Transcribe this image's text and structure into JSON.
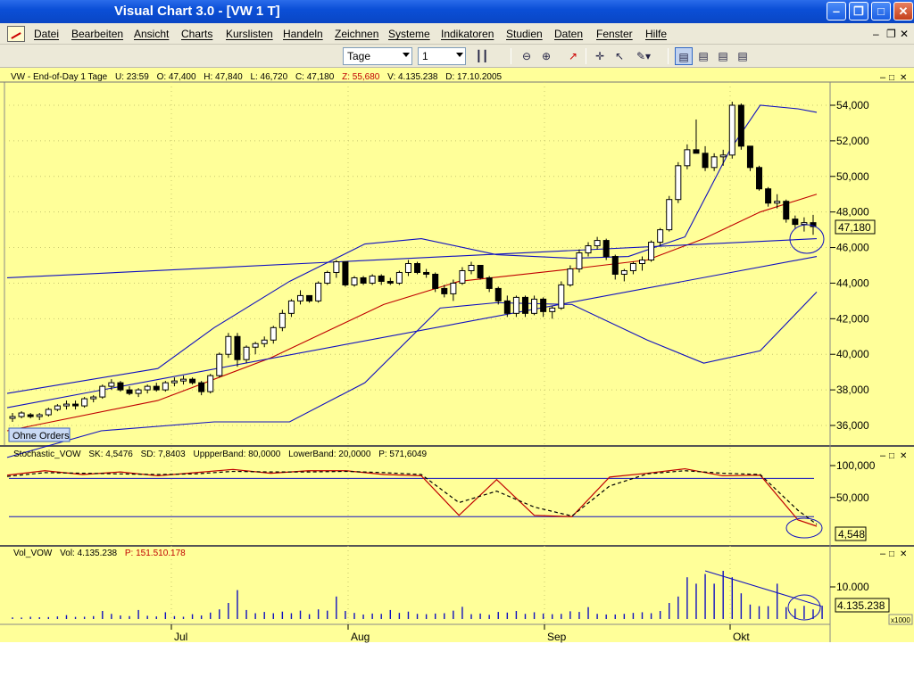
{
  "window": {
    "title": "Visual Chart  3.0 - [VW 1 T]"
  },
  "menu": [
    "Datei",
    "Bearbeiten",
    "Ansicht",
    "Charts",
    "Kurslisten",
    "Handeln",
    "Zeichnen",
    "Systeme",
    "Indikatoren",
    "Studien",
    "Daten",
    "Fenster",
    "Hilfe"
  ],
  "toolbar": {
    "period": "Tage",
    "compression": "1"
  },
  "price_header": {
    "symbol": "VW - End-of-Day 1 Tage",
    "u": "U: 23:59",
    "o": "O: 47,400",
    "h": "H: 47,840",
    "l": "L: 46,720",
    "c": "C: 47,180",
    "z": "Z: 55,680",
    "v": "V: 4.135.238",
    "d": "D: 17.10.2005"
  },
  "price_last": "47,180",
  "orders_label": "Ohne Orders",
  "stoch_header": {
    "name": "Stochastic_VOW",
    "sk": "SK: 4,5476",
    "sd": "SD: 7,8403",
    "upper": "UppperBand: 80,0000",
    "lower": "LowerBand: 20,0000",
    "p": "P: 571,6049"
  },
  "stoch_last": "4,548",
  "vol_header": {
    "name": "Vol_VOW",
    "vol": "Vol: 4.135.238",
    "p": "P: 151.510.178"
  },
  "vol_last": "4.135.238",
  "vol_scale": "x1000",
  "colors": {
    "panel_bg": "#ffff99",
    "candle_up": "#ffffff",
    "candle_down": "#000000",
    "bollinger": "#1010c0",
    "ma": "#c00000",
    "z_value": "#c00000"
  },
  "chart_data": [
    {
      "type": "candlestick",
      "title": "VW - End-of-Day 1 Tage",
      "x_labels": [
        "Jul",
        "Aug",
        "Sep",
        "Okt"
      ],
      "y_ticks": [
        "54,000",
        "52,000",
        "50,000",
        "48,000",
        "46,000",
        "44,000",
        "42,000",
        "40,000",
        "38,000",
        "36,000"
      ],
      "ylim": [
        35000,
        55000
      ],
      "candles": [
        [
          36400,
          36700,
          36200,
          36500
        ],
        [
          36500,
          36800,
          36400,
          36700
        ],
        [
          36600,
          36700,
          36400,
          36500
        ],
        [
          36500,
          36700,
          36300,
          36600
        ],
        [
          36600,
          37000,
          36500,
          36900
        ],
        [
          36900,
          37200,
          36800,
          37100
        ],
        [
          37100,
          37400,
          36900,
          37200
        ],
        [
          37200,
          37400,
          36900,
          37100
        ],
        [
          37100,
          37600,
          37000,
          37500
        ],
        [
          37500,
          37700,
          37300,
          37600
        ],
        [
          37600,
          38300,
          37500,
          38200
        ],
        [
          38200,
          38600,
          38000,
          38400
        ],
        [
          38400,
          38500,
          37900,
          38000
        ],
        [
          38000,
          38200,
          37700,
          37800
        ],
        [
          37800,
          38100,
          37600,
          38000
        ],
        [
          38000,
          38300,
          37800,
          38200
        ],
        [
          38200,
          38400,
          37900,
          38000
        ],
        [
          38000,
          38500,
          37900,
          38400
        ],
        [
          38400,
          38700,
          38200,
          38500
        ],
        [
          38500,
          38800,
          38300,
          38600
        ],
        [
          38600,
          38700,
          38300,
          38400
        ],
        [
          38400,
          38500,
          37700,
          37900
        ],
        [
          37900,
          38900,
          37800,
          38800
        ],
        [
          38800,
          40100,
          38700,
          40000
        ],
        [
          40000,
          41200,
          39800,
          41000
        ],
        [
          41000,
          41200,
          39300,
          39700
        ],
        [
          39700,
          40500,
          39500,
          40400
        ],
        [
          40400,
          40700,
          40000,
          40600
        ],
        [
          40600,
          41000,
          40400,
          40800
        ],
        [
          40800,
          41600,
          40600,
          41500
        ],
        [
          41500,
          42500,
          41300,
          42300
        ],
        [
          42300,
          43100,
          42100,
          43000
        ],
        [
          43000,
          43600,
          42800,
          43300
        ],
        [
          43300,
          43300,
          42900,
          43000
        ],
        [
          43000,
          44100,
          42900,
          44000
        ],
        [
          44000,
          44700,
          43900,
          44600
        ],
        [
          44600,
          45300,
          44300,
          45200
        ],
        [
          45200,
          45200,
          43800,
          43900
        ],
        [
          43900,
          44400,
          43800,
          44300
        ],
        [
          44300,
          44400,
          43900,
          44000
        ],
        [
          44000,
          44500,
          43900,
          44400
        ],
        [
          44400,
          44500,
          43900,
          44100
        ],
        [
          44100,
          44300,
          43900,
          44000
        ],
        [
          44000,
          44700,
          43900,
          44600
        ],
        [
          44600,
          45300,
          44400,
          45100
        ],
        [
          45100,
          45200,
          44500,
          44600
        ],
        [
          44600,
          44800,
          44300,
          44500
        ],
        [
          44500,
          44600,
          43500,
          43700
        ],
        [
          43700,
          43900,
          43200,
          43400
        ],
        [
          43400,
          44200,
          43000,
          44000
        ],
        [
          44000,
          44900,
          43900,
          44700
        ],
        [
          44700,
          45200,
          44500,
          45000
        ],
        [
          45000,
          45000,
          44200,
          44300
        ],
        [
          44300,
          44400,
          43500,
          43700
        ],
        [
          43700,
          43800,
          42800,
          43000
        ],
        [
          43000,
          43300,
          42100,
          42300
        ],
        [
          42300,
          43300,
          42100,
          43200
        ],
        [
          43200,
          43300,
          42100,
          42300
        ],
        [
          42300,
          43300,
          42200,
          43100
        ],
        [
          43100,
          43200,
          42100,
          42400
        ],
        [
          42400,
          42700,
          42000,
          42600
        ],
        [
          42600,
          44100,
          42500,
          43900
        ],
        [
          43900,
          45000,
          43800,
          44800
        ],
        [
          44800,
          45900,
          44600,
          45700
        ],
        [
          45700,
          46300,
          45500,
          46100
        ],
        [
          46100,
          46600,
          45900,
          46400
        ],
        [
          46400,
          46500,
          45300,
          45500
        ],
        [
          45500,
          45600,
          44200,
          44500
        ],
        [
          44500,
          44800,
          44100,
          44700
        ],
        [
          44700,
          45200,
          44500,
          45100
        ],
        [
          45100,
          45500,
          44700,
          45300
        ],
        [
          45300,
          46400,
          45200,
          46300
        ],
        [
          46300,
          47100,
          46100,
          47000
        ],
        [
          47000,
          48900,
          46900,
          48700
        ],
        [
          48700,
          50800,
          48500,
          50600
        ],
        [
          50600,
          51800,
          50400,
          51500
        ],
        [
          51500,
          53200,
          51300,
          51300
        ],
        [
          51300,
          51700,
          50300,
          50500
        ],
        [
          50500,
          51300,
          50300,
          51100
        ],
        [
          51100,
          51500,
          50600,
          51200
        ],
        [
          51200,
          54200,
          51000,
          54000
        ],
        [
          54000,
          54100,
          51500,
          51700
        ],
        [
          51700,
          51700,
          50300,
          50500
        ],
        [
          50500,
          50600,
          49200,
          49300
        ],
        [
          49300,
          49400,
          48300,
          48500
        ],
        [
          48500,
          49000,
          48200,
          48600
        ],
        [
          48600,
          48700,
          47400,
          47600
        ],
        [
          47600,
          47800,
          47100,
          47300
        ],
        [
          47300,
          47700,
          46900,
          47400
        ],
        [
          47400,
          47840,
          46720,
          47180
        ]
      ],
      "bollinger_upper": [
        [
          0,
          37800
        ],
        [
          40,
          39200
        ],
        [
          55,
          41500
        ],
        [
          75,
          44100
        ],
        [
          95,
          46200
        ],
        [
          110,
          46500
        ],
        [
          130,
          45600
        ],
        [
          150,
          45400
        ],
        [
          165,
          45500
        ],
        [
          180,
          46600
        ],
        [
          192,
          51500
        ],
        [
          200,
          54000
        ],
        [
          210,
          53800
        ],
        [
          215,
          53600
        ]
      ],
      "bollinger_lower": [
        [
          0,
          34200
        ],
        [
          25,
          35700
        ],
        [
          55,
          36200
        ],
        [
          75,
          36200
        ],
        [
          95,
          38400
        ],
        [
          115,
          42600
        ],
        [
          130,
          42900
        ],
        [
          150,
          42800
        ],
        [
          170,
          40800
        ],
        [
          185,
          39500
        ],
        [
          200,
          40200
        ],
        [
          215,
          43500
        ]
      ],
      "moving_average": [
        [
          0,
          35700
        ],
        [
          40,
          37400
        ],
        [
          70,
          39800
        ],
        [
          100,
          42800
        ],
        [
          120,
          44100
        ],
        [
          150,
          44800
        ],
        [
          170,
          45300
        ],
        [
          185,
          46500
        ],
        [
          200,
          48000
        ],
        [
          215,
          49000
        ]
      ],
      "trendlines": [
        [
          [
            0,
            44300
          ],
          [
            215,
            46500
          ]
        ],
        [
          [
            0,
            37000
          ],
          [
            215,
            45500
          ]
        ]
      ]
    },
    {
      "type": "line",
      "title": "Stochastic_VOW",
      "y_ticks": [
        "100,000",
        "50,000"
      ],
      "bands": [
        80,
        20
      ],
      "sk": [
        [
          0,
          85
        ],
        [
          10,
          92
        ],
        [
          20,
          86
        ],
        [
          30,
          90
        ],
        [
          40,
          84
        ],
        [
          50,
          89
        ],
        [
          60,
          94
        ],
        [
          70,
          88
        ],
        [
          80,
          92
        ],
        [
          90,
          92
        ],
        [
          100,
          86
        ],
        [
          110,
          84
        ],
        [
          120,
          22
        ],
        [
          130,
          78
        ],
        [
          140,
          22
        ],
        [
          150,
          20
        ],
        [
          160,
          82
        ],
        [
          170,
          88
        ],
        [
          180,
          95
        ],
        [
          190,
          84
        ],
        [
          200,
          85
        ],
        [
          210,
          15
        ],
        [
          215,
          5
        ]
      ],
      "sd": [
        [
          0,
          83
        ],
        [
          10,
          89
        ],
        [
          20,
          88
        ],
        [
          30,
          87
        ],
        [
          40,
          86
        ],
        [
          50,
          87
        ],
        [
          60,
          91
        ],
        [
          70,
          90
        ],
        [
          80,
          90
        ],
        [
          90,
          91
        ],
        [
          100,
          89
        ],
        [
          110,
          86
        ],
        [
          120,
          42
        ],
        [
          130,
          60
        ],
        [
          140,
          35
        ],
        [
          150,
          21
        ],
        [
          160,
          68
        ],
        [
          170,
          87
        ],
        [
          180,
          92
        ],
        [
          190,
          88
        ],
        [
          200,
          86
        ],
        [
          210,
          30
        ],
        [
          215,
          8
        ]
      ]
    },
    {
      "type": "bar",
      "title": "Vol_VOW",
      "y_ticks": [
        "10.000"
      ],
      "unit": "x1000",
      "values": [
        500,
        450,
        700,
        550,
        600,
        800,
        1200,
        650,
        700,
        900,
        2500,
        1600,
        1100,
        900,
        2800,
        1000,
        800,
        2100,
        900,
        700,
        1500,
        1100,
        2000,
        3000,
        5000,
        9000,
        2800,
        1800,
        2200,
        1800,
        2300,
        1800,
        2600,
        1500,
        3000,
        2600,
        7000,
        2500,
        1900,
        1400,
        1700,
        1600,
        2800,
        1900,
        2300,
        1600,
        1500,
        1700,
        1800,
        2600,
        3800,
        1500,
        1700,
        1300,
        2200,
        2000,
        2500,
        1600,
        2100,
        1700,
        1500,
        1600,
        2400,
        2200,
        3700,
        1600,
        1400,
        1400,
        1600,
        1900,
        2100,
        1800,
        2500,
        5000,
        7000,
        13000,
        11000,
        14000,
        11000,
        15000,
        13000,
        8000,
        4500,
        4000,
        4000,
        11000,
        3700,
        3200,
        4100,
        3000,
        4135
      ]
    }
  ]
}
